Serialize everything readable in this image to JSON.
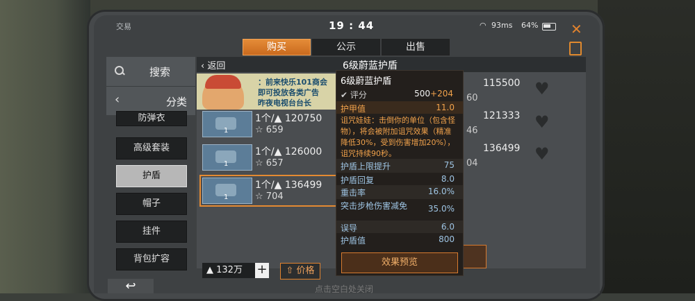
{
  "status": {
    "app": "交易",
    "time": "19 : 44",
    "ping": "93ms",
    "battery": "64%"
  },
  "tabs": [
    "购买",
    "公示",
    "出售"
  ],
  "left": {
    "search": "搜索",
    "category": "分类",
    "items": [
      "防弹衣",
      "高级套装",
      "护盾",
      "帽子",
      "挂件",
      "背包扩容"
    ],
    "active_index": 2
  },
  "header": {
    "back": "返回",
    "title": "6级蔚蓝护盾"
  },
  "banner": {
    "lines": [
      "：前来快乐101商会",
      "即可投放各类广告",
      "昨夜电视台台长"
    ]
  },
  "listings": [
    {
      "qty": "1个/",
      "price": "120750",
      "rating": "659",
      "badge": "1"
    },
    {
      "qty": "1个/",
      "price": "126000",
      "rating": "657",
      "badge": "1"
    },
    {
      "qty": "1个/",
      "price": "136499",
      "rating": "704",
      "badge": "1"
    }
  ],
  "right_listings": [
    {
      "price": "115500",
      "rating": "60"
    },
    {
      "price": "121333",
      "rating": "46"
    },
    {
      "price": "136499",
      "rating": "04"
    }
  ],
  "bottom": {
    "money": "132万",
    "price_label": "价格",
    "buy_label": "购买",
    "close_hint": "点击空白处关闭"
  },
  "tooltip": {
    "title": "6级蔚蓝护盾",
    "score_label": "评分",
    "score_base": "500",
    "score_plus": "+204",
    "armor_label": "护甲值",
    "armor_value": "11.0",
    "desc": "诅咒娃娃：击倒你的单位（包含怪物），将会被附加诅咒效果（精准降低30%，受到伤害增加20%），诅咒持续90秒。",
    "stats": [
      {
        "label": "护盾上限提升",
        "value": "75"
      },
      {
        "label": "护盾回复",
        "value": "8.0"
      },
      {
        "label": "重击率",
        "value": "16.0%"
      },
      {
        "label": "突击步枪伤害减免",
        "value": "35.0%"
      },
      {
        "label": "误导",
        "value": "6.0"
      },
      {
        "label": "护盾值",
        "value": "800"
      }
    ],
    "preview_label": "效果预览"
  },
  "colors": {
    "accent": "#e2832e",
    "tooltip_orange": "#f1a24b",
    "tooltip_blue": "#9ec4e3"
  }
}
